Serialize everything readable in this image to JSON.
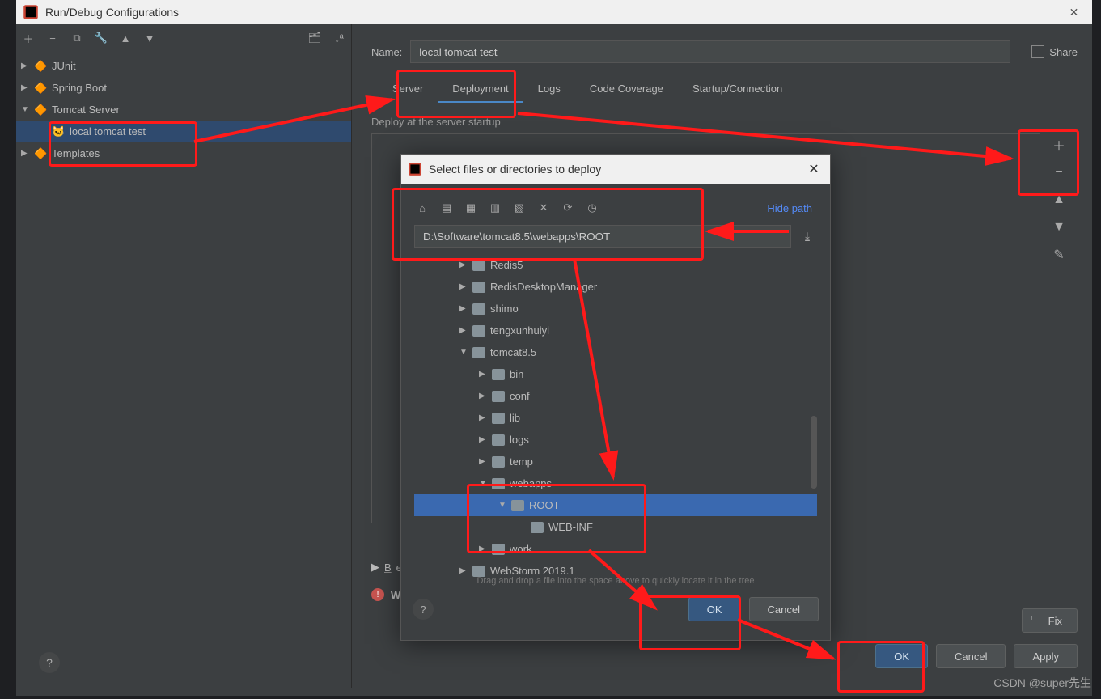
{
  "window": {
    "title": "Run/Debug Configurations"
  },
  "sidebar": {
    "nodes": [
      {
        "label": "JUnit",
        "indent": 0,
        "expand": "▶"
      },
      {
        "label": "Spring Boot",
        "indent": 0,
        "expand": "▶"
      },
      {
        "label": "Tomcat Server",
        "indent": 0,
        "expand": "▼"
      },
      {
        "label": "local tomcat test",
        "indent": 1,
        "expand": "",
        "selected": true
      },
      {
        "label": "Templates",
        "indent": 0,
        "expand": "▶"
      }
    ]
  },
  "main": {
    "name_label": "Name:",
    "name_value": "local tomcat test",
    "share_label": "Share",
    "tabs": [
      {
        "label": "Server"
      },
      {
        "label": "Deployment",
        "active": true
      },
      {
        "label": "Logs"
      },
      {
        "label": "Code Coverage"
      },
      {
        "label": "Startup/Connection"
      }
    ],
    "deploy_label": "Deploy at the server startup",
    "before_label": "Before",
    "warning_label": "Warnin",
    "fix_label": "Fix",
    "ok": "OK",
    "cancel": "Cancel",
    "apply": "Apply"
  },
  "dialog": {
    "title": "Select files or directories to deploy",
    "hidepath": "Hide path",
    "path_value": "D:\\Software\\tomcat8.5\\webapps\\ROOT",
    "drag_hint": "Drag and drop a file into the space above to quickly locate it in the tree",
    "ok": "OK",
    "cancel": "Cancel",
    "tree": [
      {
        "d": 0,
        "exp": "▶",
        "name": "Redis5"
      },
      {
        "d": 0,
        "exp": "▶",
        "name": "RedisDesktopManager"
      },
      {
        "d": 0,
        "exp": "▶",
        "name": "shimo"
      },
      {
        "d": 0,
        "exp": "▶",
        "name": "tengxunhuiyi"
      },
      {
        "d": 0,
        "exp": "▼",
        "name": "tomcat8.5"
      },
      {
        "d": 1,
        "exp": "▶",
        "name": "bin"
      },
      {
        "d": 1,
        "exp": "▶",
        "name": "conf"
      },
      {
        "d": 1,
        "exp": "▶",
        "name": "lib"
      },
      {
        "d": 1,
        "exp": "▶",
        "name": "logs"
      },
      {
        "d": 1,
        "exp": "▶",
        "name": "temp"
      },
      {
        "d": 1,
        "exp": "▼",
        "name": "webapps"
      },
      {
        "d": 2,
        "exp": "▼",
        "name": "ROOT",
        "selected": true
      },
      {
        "d": 3,
        "exp": "",
        "name": "WEB-INF"
      },
      {
        "d": 1,
        "exp": "▶",
        "name": "work"
      },
      {
        "d": 0,
        "exp": "▶",
        "name": "WebStorm 2019.1"
      }
    ]
  },
  "watermark": "CSDN @super先生"
}
